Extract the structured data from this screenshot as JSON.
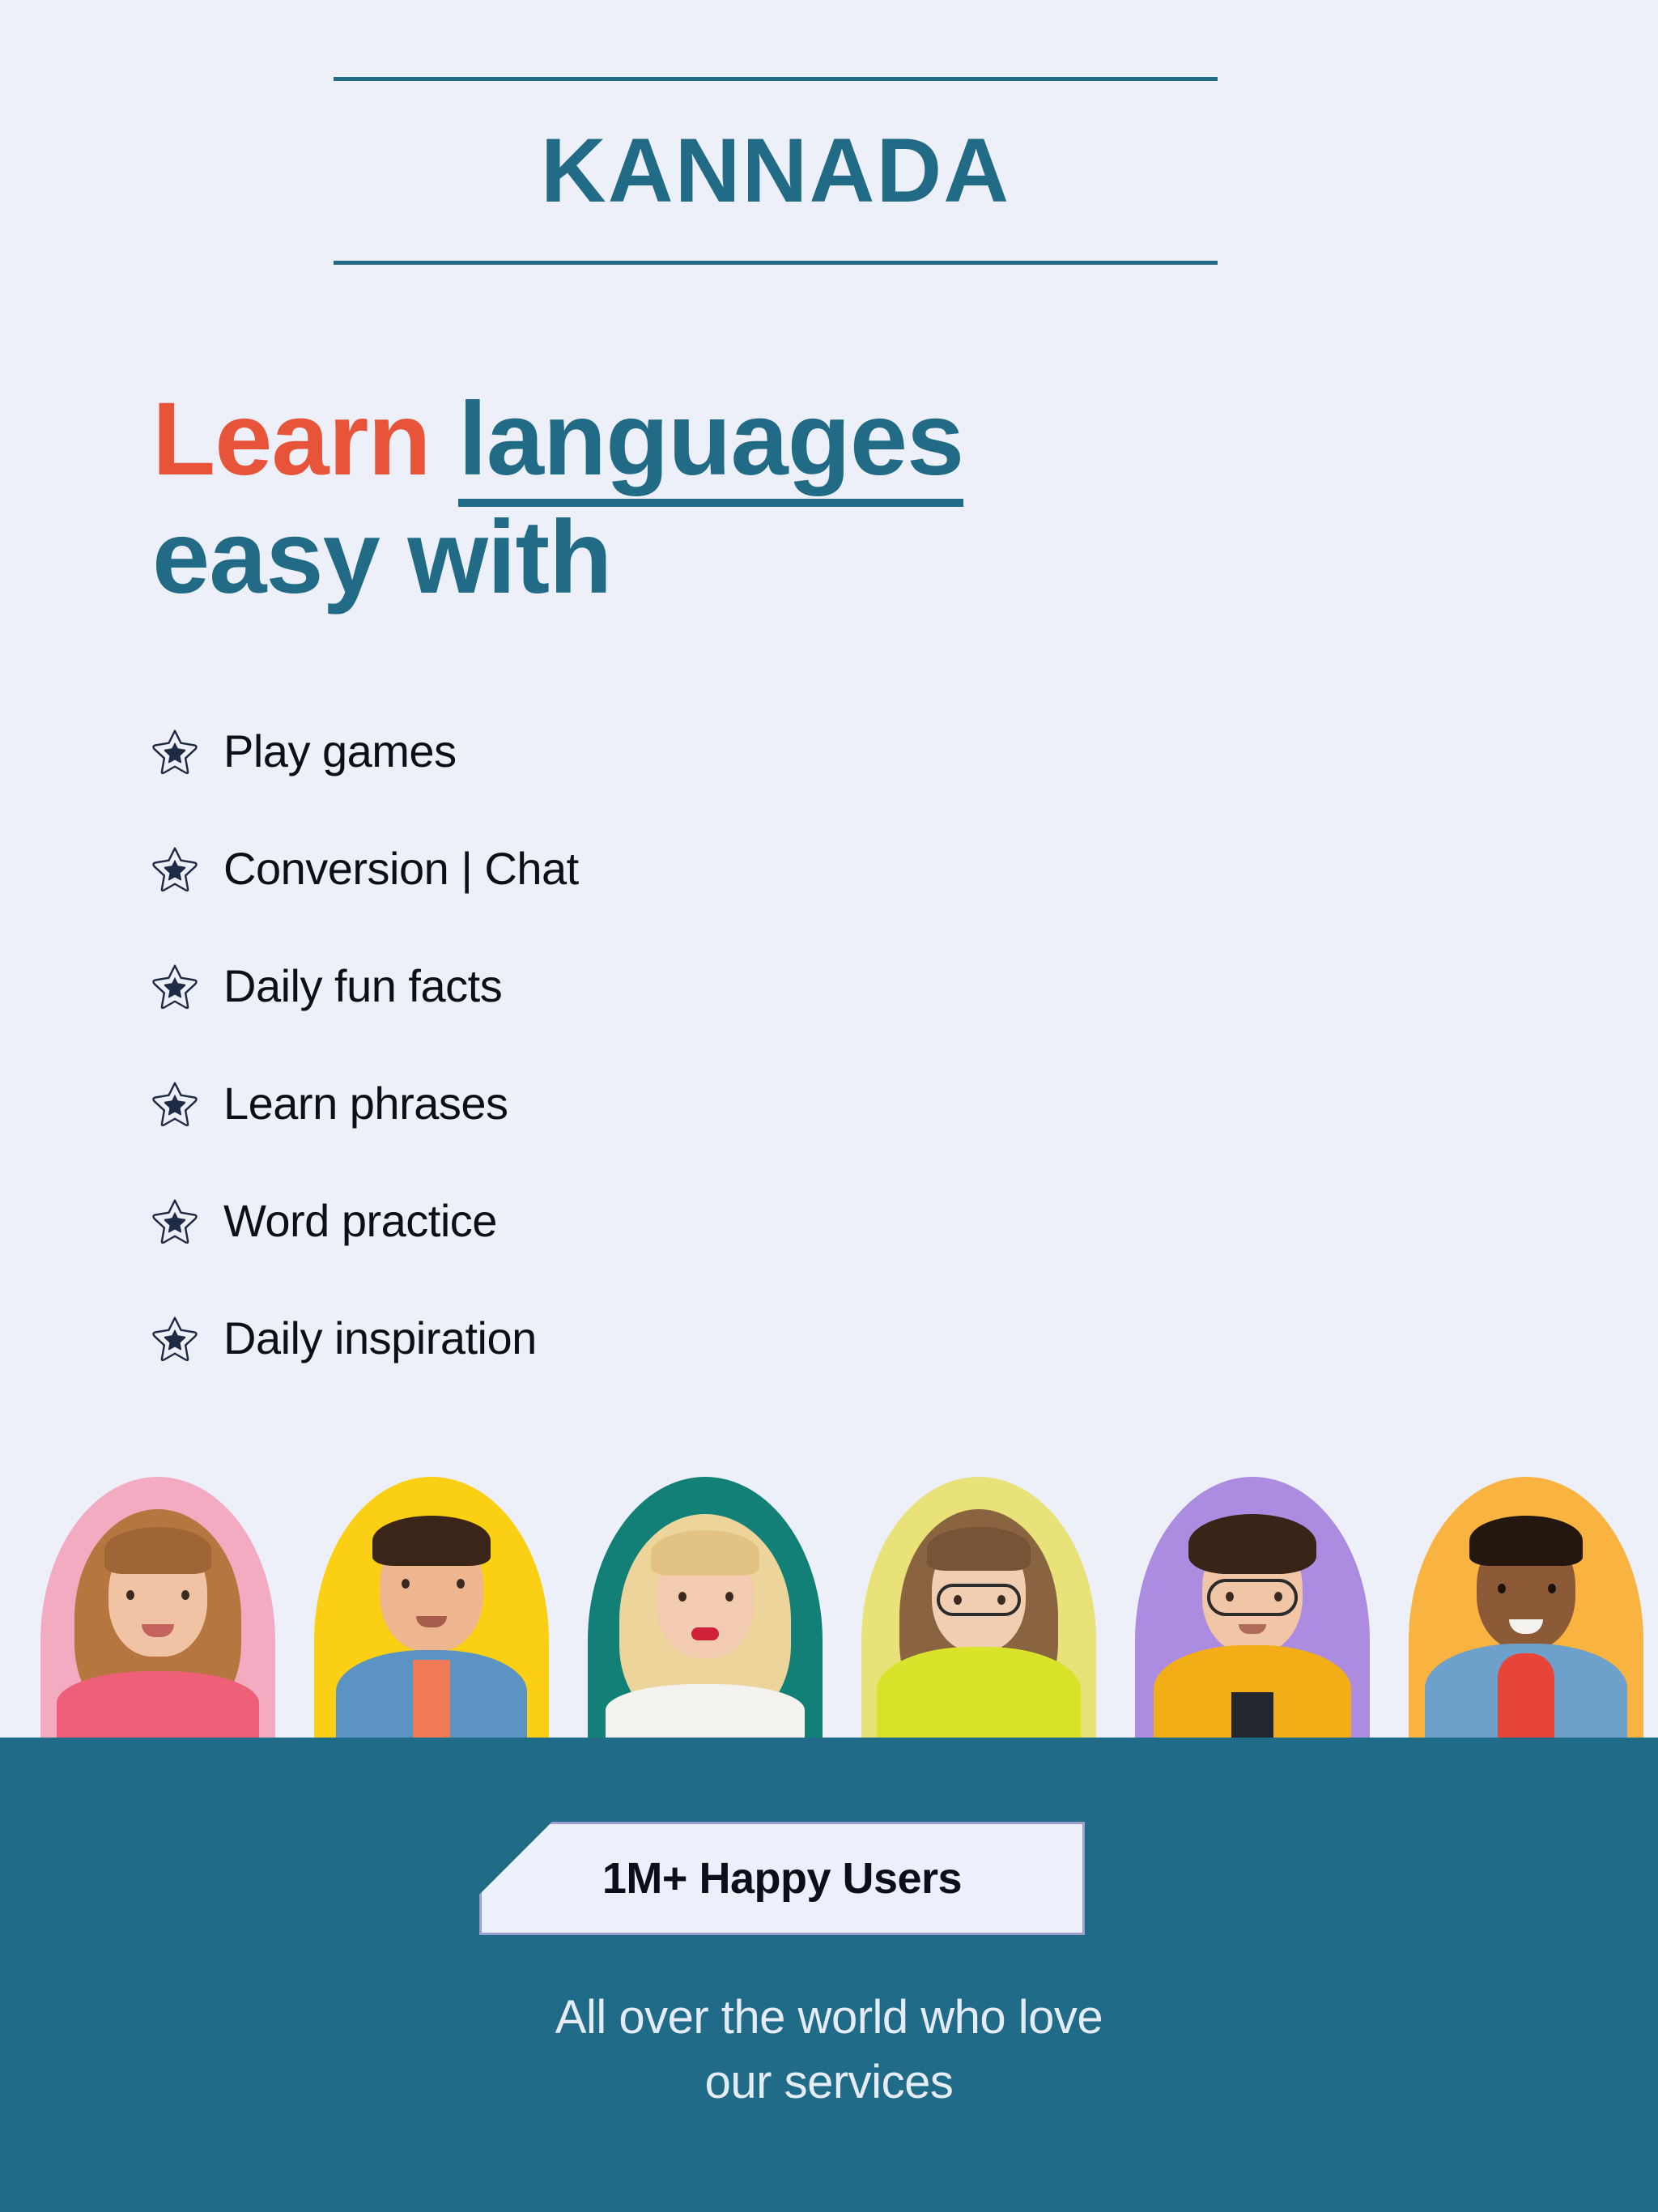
{
  "theme": {
    "background": "#edf0f9",
    "teal": "#226b87",
    "banner_teal": "#206b88",
    "orange": "#e8543a",
    "ink": "#0a0f19",
    "badge_bg": "#ecf0fa",
    "badge_border": "#9b9fd0",
    "tagline_color": "#e6ecf5"
  },
  "header": {
    "title": "KANNADA",
    "rule_top_icon": "horizontal-rule",
    "rule_bottom_icon": "horizontal-rule"
  },
  "headline": {
    "word_learn": "Learn",
    "word_languages": "languages",
    "line_two": "easy with"
  },
  "features": {
    "bullet_icon": "star-icon",
    "items": [
      {
        "label": "Play games"
      },
      {
        "label": "Conversion | Chat"
      },
      {
        "label": "Daily fun facts"
      },
      {
        "label": "Learn phrases"
      },
      {
        "label": "Word practice"
      },
      {
        "label": "Daily inspiration"
      }
    ]
  },
  "avatars": {
    "items": [
      {
        "name": "avatar-woman-curly-hair",
        "bg": "#f3abc1",
        "skin": "#f0c3a4",
        "hair": "#b5763f",
        "cloth": "#ee5f78"
      },
      {
        "name": "avatar-man-denim-shirt",
        "bg": "#fbd014",
        "skin": "#edb68f",
        "hair": "#3b2519",
        "cloth": "#5b94c4"
      },
      {
        "name": "avatar-woman-blonde-thinking",
        "bg": "#128077",
        "skin": "#f2cbb0",
        "hair": "#ecd49a",
        "cloth": "#f4f2ee"
      },
      {
        "name": "avatar-woman-glasses-yellow-hoodie",
        "bg": "#e8e279",
        "skin": "#f1cdb2",
        "hair": "#8a6440",
        "cloth": "#d8e32a"
      },
      {
        "name": "avatar-teen-glasses-yellow-hoodie",
        "bg": "#ab8ce0",
        "skin": "#f0c6a6",
        "hair": "#3a2418",
        "cloth": "#f2ad17"
      },
      {
        "name": "avatar-man-thumbs-up-denim",
        "bg": "#f9b340",
        "skin": "#8d5a38",
        "hair": "#241710",
        "cloth": "#6ea0cc"
      }
    ]
  },
  "banner": {
    "badge_label": "1M+ Happy Users",
    "tagline_line1": "All over the world who love",
    "tagline_line2": "our services"
  }
}
